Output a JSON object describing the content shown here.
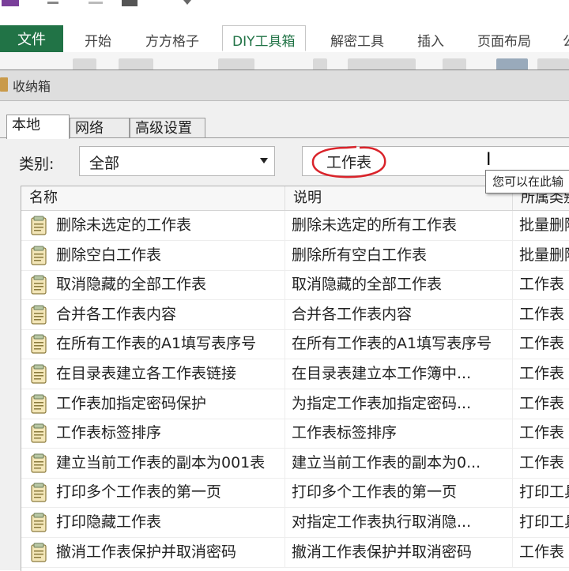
{
  "ribbon": {
    "file_tab": "文件",
    "tabs": [
      "开始",
      "方方格子",
      "DIY工具箱",
      "解密工具",
      "插入",
      "页面布局",
      "公"
    ]
  },
  "dialog": {
    "title": "收纳箱",
    "tabs": [
      "本地",
      "网络",
      "高级设置"
    ],
    "category_label": "类别:",
    "category_value": "全部",
    "search_value": "工作表",
    "tooltip": "您可以在此输",
    "columns": [
      "名称",
      "说明",
      "所属类别"
    ],
    "rows": [
      {
        "name": "删除未选定的工作表",
        "desc": "删除未选定的所有工作表",
        "cat": "批量删除"
      },
      {
        "name": "删除空白工作表",
        "desc": "删除所有空白工作表",
        "cat": "批量删除"
      },
      {
        "name": "取消隐藏的全部工作表",
        "desc": "取消隐藏的全部工作表",
        "cat": "工作表"
      },
      {
        "name": "合并各工作表内容",
        "desc": "合并各工作表内容",
        "cat": "工作表"
      },
      {
        "name": "在所有工作表的A1填写表序号",
        "desc": "在所有工作表的A1填写表序号",
        "cat": "工作表"
      },
      {
        "name": "在目录表建立各工作表链接",
        "desc": "在目录表建立本工作簿中...",
        "cat": "工作表"
      },
      {
        "name": "工作表加指定密码保护",
        "desc": "为指定工作表加指定密码...",
        "cat": "工作表"
      },
      {
        "name": "工作表标签排序",
        "desc": "工作表标签排序",
        "cat": "工作表"
      },
      {
        "name": "建立当前工作表的副本为001表",
        "desc": "建立当前工作表的副本为0...",
        "cat": "工作表"
      },
      {
        "name": "打印多个工作表的第一页",
        "desc": "打印多个工作表的第一页",
        "cat": "打印工具"
      },
      {
        "name": "打印隐藏工作表",
        "desc": "对指定工作表执行取消隐...",
        "cat": "打印工具"
      },
      {
        "name": "撤消工作表保护并取消密码",
        "desc": "撤消工作表保护并取消密码",
        "cat": "工作表"
      }
    ]
  },
  "colors": {
    "excel_green": "#217346",
    "annotation_red": "#d9232a"
  }
}
